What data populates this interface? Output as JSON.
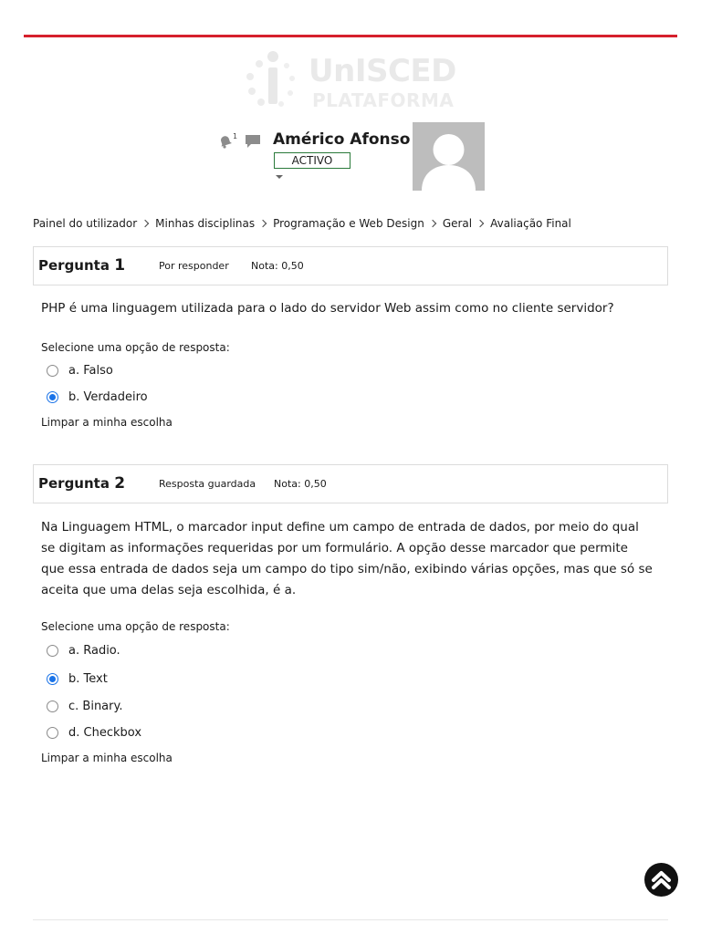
{
  "brand": {
    "logo_main": "UnISCED",
    "logo_sub": "PLATAFORMA"
  },
  "user_menu": {
    "notification_count": "1",
    "user_name": "Américo Afonso",
    "status": "ACTIVO"
  },
  "breadcrumb": [
    "Painel do utilizador",
    "Minhas disciplinas",
    "Programação e Web Design",
    "Geral",
    "Avaliação Final"
  ],
  "questions": [
    {
      "label": "Pergunta",
      "number": "1",
      "state": "Por responder",
      "grade": "Nota: 0,50",
      "text": "PHP é uma linguagem utilizada para o lado do servidor Web assim como no cliente servidor?",
      "prompt": "Selecione uma opção de resposta:",
      "options": [
        {
          "label": "a. Falso",
          "checked": false
        },
        {
          "label": "b. Verdadeiro",
          "checked": true
        }
      ],
      "clear_label": "Limpar a minha escolha"
    },
    {
      "label": "Pergunta",
      "number": "2",
      "state": "Resposta guardada",
      "grade": "Nota: 0,50",
      "text": "Na Linguagem HTML, o marcador input define um campo de entrada de dados, por meio do qual se digitam as informações requeridas por um formulário. A opção desse marcador que permite que essa entrada de dados seja um campo do tipo sim/não, exibindo várias opções, mas que só se aceita que uma delas seja escolhida, é a.",
      "prompt": "Selecione uma opção de resposta:",
      "options": [
        {
          "label": "a. Radio.",
          "checked": false
        },
        {
          "label": "b. Text",
          "checked": true
        },
        {
          "label": "c. Binary.",
          "checked": false
        },
        {
          "label": "d. Checkbox",
          "checked": false
        }
      ],
      "clear_label": "Limpar a minha escolha"
    }
  ],
  "colors": {
    "accent_rule": "#d6202c",
    "radio_checked": "#1a73e8",
    "status_border": "#2a7a3a"
  },
  "icons": {
    "notifications": "bell-icon",
    "messages": "chat-icon",
    "back_to_top": "chevron-up-icon"
  }
}
